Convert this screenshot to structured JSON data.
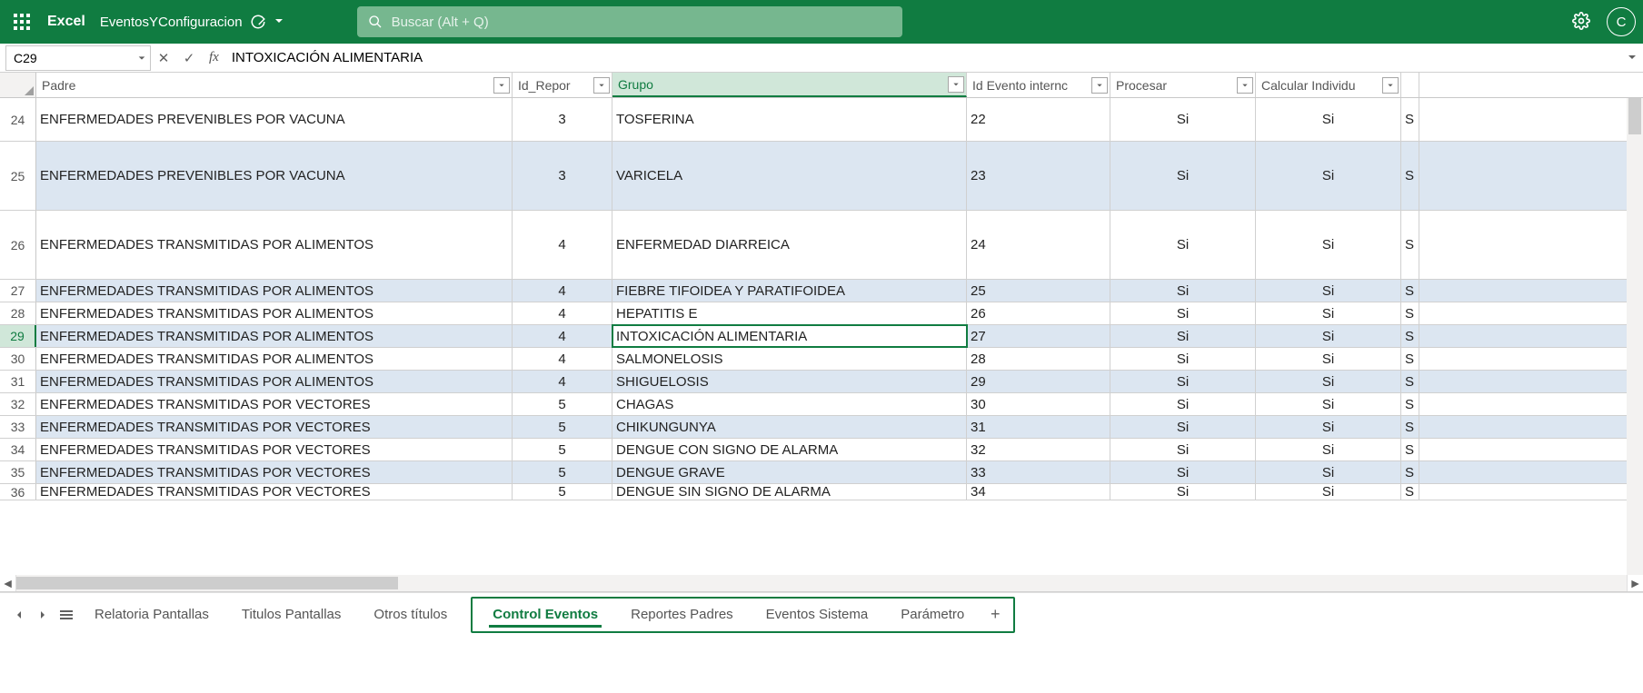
{
  "header": {
    "app_name": "Excel",
    "doc_name": "EventosYConfiguracion",
    "search_placeholder": "Buscar (Alt + Q)",
    "avatar_initial": "C"
  },
  "formula_bar": {
    "name_box": "C29",
    "formula": "INTOXICACIÓN ALIMENTARIA"
  },
  "columns": [
    {
      "label": "Padre",
      "key": "padre",
      "class": "w-padre"
    },
    {
      "label": "Id_Repor",
      "key": "idrep",
      "class": "w-id"
    },
    {
      "label": "Grupo",
      "key": "grupo",
      "class": "w-grupo",
      "active": true
    },
    {
      "label": "Id Evento internc",
      "key": "idevt",
      "class": "w-evtint"
    },
    {
      "label": "Procesar",
      "key": "proc",
      "class": "w-proc"
    },
    {
      "label": "Calcular Individu",
      "key": "calc",
      "class": "w-calc"
    }
  ],
  "rows": [
    {
      "n": 24,
      "h": "tall",
      "alt": false,
      "padre": "ENFERMEDADES PREVENIBLES POR VACUNA",
      "idrep": "3",
      "grupo": "TOSFERINA",
      "idevt": "22",
      "proc": "Si",
      "calc": "Si",
      "last": "S"
    },
    {
      "n": 25,
      "h": "tall2",
      "alt": true,
      "padre": "ENFERMEDADES PREVENIBLES POR VACUNA",
      "idrep": "3",
      "grupo": "VARICELA",
      "idevt": "23",
      "proc": "Si",
      "calc": "Si",
      "last": "S"
    },
    {
      "n": 26,
      "h": "tall3",
      "alt": false,
      "padre": "ENFERMEDADES TRANSMITIDAS POR ALIMENTOS",
      "idrep": "4",
      "grupo": "ENFERMEDAD DIARREICA",
      "idevt": "24",
      "proc": "Si",
      "calc": "Si",
      "last": "S"
    },
    {
      "n": 27,
      "h": "reg",
      "alt": true,
      "padre": "ENFERMEDADES TRANSMITIDAS POR ALIMENTOS",
      "idrep": "4",
      "grupo": "FIEBRE TIFOIDEA Y PARATIFOIDEA",
      "idevt": "25",
      "proc": "Si",
      "calc": "Si",
      "last": "S"
    },
    {
      "n": 28,
      "h": "reg",
      "alt": false,
      "padre": "ENFERMEDADES TRANSMITIDAS POR ALIMENTOS",
      "idrep": "4",
      "grupo": "HEPATITIS E",
      "idevt": "26",
      "proc": "Si",
      "calc": "Si",
      "last": "S"
    },
    {
      "n": 29,
      "h": "reg",
      "alt": true,
      "padre": "ENFERMEDADES TRANSMITIDAS POR ALIMENTOS",
      "idrep": "4",
      "grupo": "INTOXICACIÓN ALIMENTARIA",
      "idevt": "27",
      "proc": "Si",
      "calc": "Si",
      "last": "S",
      "selected": true
    },
    {
      "n": 30,
      "h": "reg",
      "alt": false,
      "padre": "ENFERMEDADES TRANSMITIDAS POR ALIMENTOS",
      "idrep": "4",
      "grupo": "SALMONELOSIS",
      "idevt": "28",
      "proc": "Si",
      "calc": "Si",
      "last": "S"
    },
    {
      "n": 31,
      "h": "reg",
      "alt": true,
      "padre": "ENFERMEDADES TRANSMITIDAS POR ALIMENTOS",
      "idrep": "4",
      "grupo": "SHIGUELOSIS",
      "idevt": "29",
      "proc": "Si",
      "calc": "Si",
      "last": "S"
    },
    {
      "n": 32,
      "h": "reg",
      "alt": false,
      "padre": "ENFERMEDADES TRANSMITIDAS POR VECTORES",
      "idrep": "5",
      "grupo": "CHAGAS",
      "idevt": "30",
      "proc": "Si",
      "calc": "Si",
      "last": "S"
    },
    {
      "n": 33,
      "h": "reg",
      "alt": true,
      "padre": "ENFERMEDADES TRANSMITIDAS POR VECTORES",
      "idrep": "5",
      "grupo": "CHIKUNGUNYA",
      "idevt": "31",
      "proc": "Si",
      "calc": "Si",
      "last": "S"
    },
    {
      "n": 34,
      "h": "reg",
      "alt": false,
      "padre": "ENFERMEDADES TRANSMITIDAS POR VECTORES",
      "idrep": "5",
      "grupo": "DENGUE CON SIGNO DE ALARMA",
      "idevt": "32",
      "proc": "Si",
      "calc": "Si",
      "last": "S"
    },
    {
      "n": 35,
      "h": "reg",
      "alt": true,
      "padre": "ENFERMEDADES TRANSMITIDAS POR VECTORES",
      "idrep": "5",
      "grupo": "DENGUE GRAVE",
      "idevt": "33",
      "proc": "Si",
      "calc": "Si",
      "last": "S"
    },
    {
      "n": 36,
      "h": "cut",
      "alt": false,
      "padre": "ENFERMEDADES TRANSMITIDAS POR VECTORES",
      "idrep": "5",
      "grupo": "DENGUE SIN SIGNO DE ALARMA",
      "idevt": "34",
      "proc": "Si",
      "calc": "Si",
      "last": "S"
    }
  ],
  "tabs_outside": [
    "Relatoria Pantallas",
    "Titulos Pantallas",
    "Otros títulos"
  ],
  "tabs_inside": [
    {
      "label": "Control Eventos",
      "active": true
    },
    {
      "label": "Reportes Padres"
    },
    {
      "label": "Eventos Sistema"
    },
    {
      "label": "Parámetro"
    }
  ]
}
